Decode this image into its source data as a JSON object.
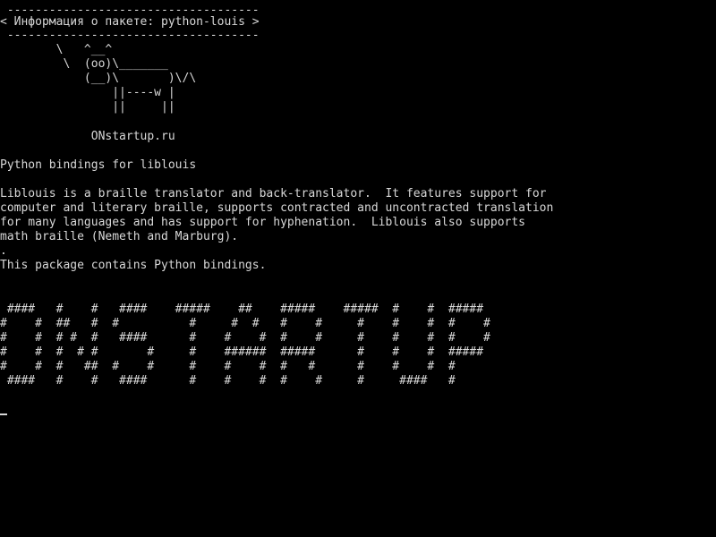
{
  "terminal": {
    "bubble": {
      "top_border": " ------------------------------------",
      "title": "< Информация о пакете: python-louis >",
      "bottom_border": " ------------------------------------"
    },
    "cow": [
      "        \\   ^__^",
      "         \\  (oo)\\_______",
      "            (__)\\       )\\/\\",
      "                ||----w |",
      "                ||     ||"
    ],
    "site": "             ONstartup.ru",
    "description": [
      "Python bindings for liblouis",
      "",
      "Liblouis is a braille translator and back-translator.  It features support for",
      "computer and literary braille, supports contracted and uncontracted translation",
      "for many languages and has support for hyphenation.  Liblouis also supports",
      "math braille (Nemeth and Marburg).",
      ".",
      "This package contains Python bindings."
    ],
    "banner": [
      " ####   #    #   ####    #####    ##    #####    #####  #    #  #####",
      "#    #  ##   #  #          #     #  #   #    #     #    #    #  #    #",
      "#    #  # #  #   ####      #    #    #  #    #     #    #    #  #    #",
      "#    #  #  # #       #     #    ######  #####      #    #    #  #####",
      "#    #  #   ##  #    #     #    #    #  #   #      #    #    #  #",
      " ####   #    #   ####      #    #    #  #    #     #     ####   #"
    ],
    "cursor": "cursor"
  }
}
